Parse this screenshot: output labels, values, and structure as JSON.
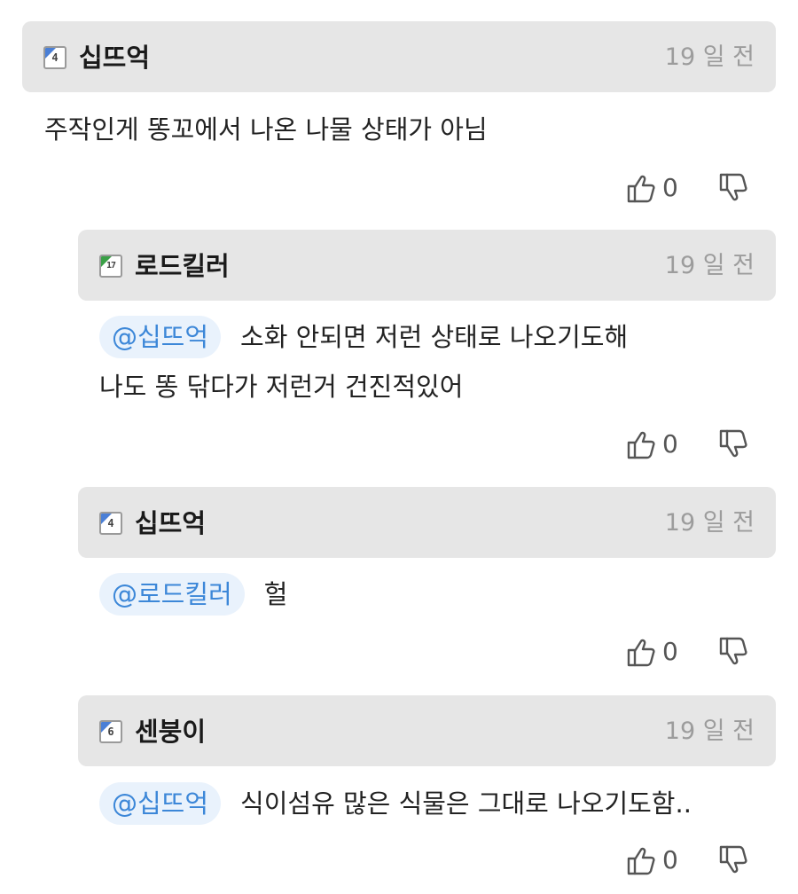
{
  "comments": [
    {
      "username": "십뜨억",
      "level": "4",
      "time": "19 일 전",
      "mention": "",
      "lines": [
        "주작인게 똥꼬에서 나온 나물 상태가 아님"
      ],
      "likes": "0"
    },
    {
      "username": "로드킬러",
      "level": "17",
      "time": "19 일 전",
      "mention": "@십뜨억",
      "lines": [
        "소화 안되면 저런 상태로 나오기도해",
        "나도 똥 닦다가 저런거 건진적있어"
      ],
      "likes": "0"
    },
    {
      "username": "십뜨억",
      "level": "4",
      "time": "19 일 전",
      "mention": "@로드킬러",
      "lines": [
        "헐"
      ],
      "likes": "0"
    },
    {
      "username": "센붕이",
      "level": "6",
      "time": "19 일 전",
      "mention": "@십뜨억",
      "lines": [
        "식이섬유 많은 식물은 그대로 나오기도함.."
      ],
      "likes": "0"
    }
  ],
  "colors": {
    "header_bg": "#e6e6e6",
    "mention_bg": "#e9f2fc",
    "mention_text": "#3c87d8",
    "time_text": "#9c9c9c",
    "badge_blue": "#4a7fd6",
    "badge_green": "#3aa047"
  },
  "icons": {
    "like": "thumbs-up-icon",
    "dislike": "thumbs-down-icon",
    "level": "level-badge-icon"
  }
}
